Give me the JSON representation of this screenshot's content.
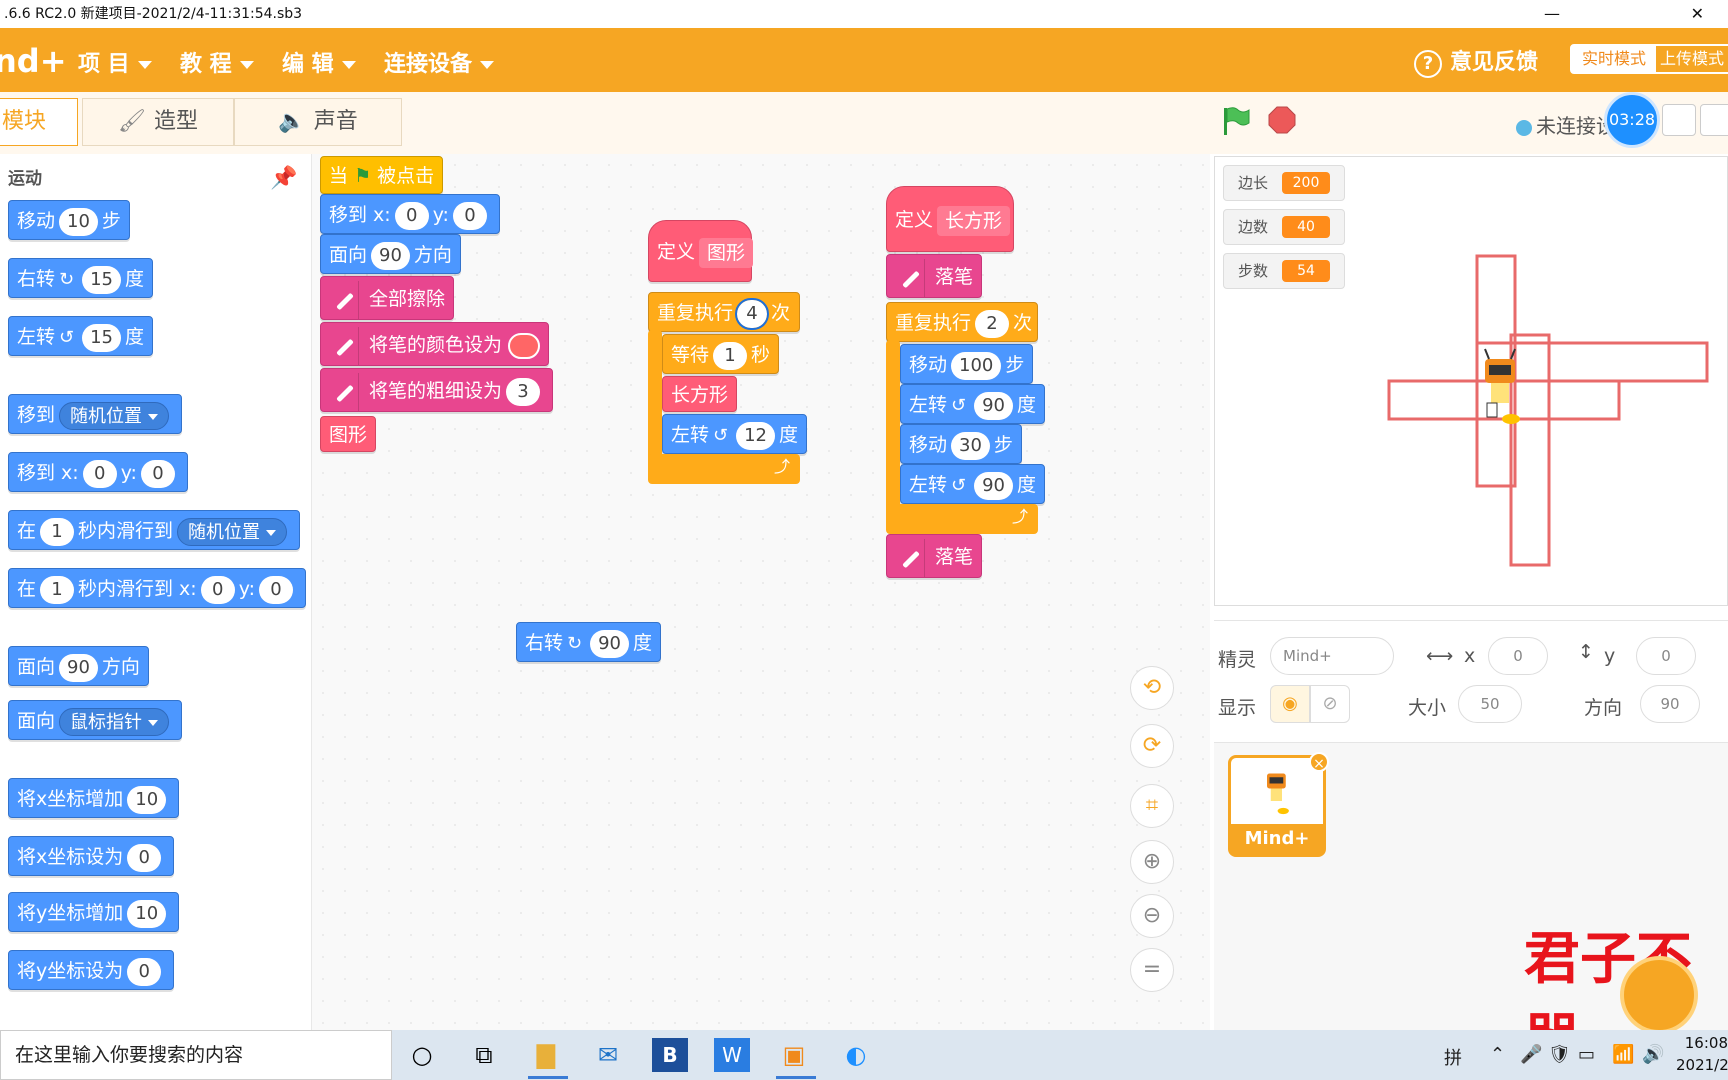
{
  "window": {
    "title": ".6.6 RC2.0   新建项目-2021/2/4-11:31:54.sb3",
    "min_glyph": "—",
    "close_glyph": "✕"
  },
  "menubar": {
    "logo": "nd+",
    "items": [
      "项 目",
      "教 程",
      "编 辑",
      "连接设备"
    ],
    "feedback": "意见反馈",
    "mode_realtime": "实时模式",
    "mode_upload": "上传模式"
  },
  "tabs": [
    {
      "label": "模块",
      "active": true
    },
    {
      "label": "造型",
      "active": false
    },
    {
      "label": "声音",
      "active": false
    }
  ],
  "stage_header": {
    "connection": "未连接设",
    "timer": "03:28"
  },
  "palette": {
    "category": "运动",
    "blocks": {
      "move": {
        "pre": "移动",
        "val": "10",
        "post": "步"
      },
      "turn_right": {
        "pre": "右转",
        "val": "15",
        "post": "度"
      },
      "turn_left": {
        "pre": "左转",
        "val": "15",
        "post": "度"
      },
      "goto_random": {
        "pre": "移到",
        "drop": "随机位置"
      },
      "goto_xy": {
        "pre": "移到 x:",
        "x": "0",
        "ylbl": "y:",
        "y": "0"
      },
      "glide_random": {
        "pre": "在",
        "val": "1",
        "mid": "秒内滑行到",
        "drop": "随机位置"
      },
      "glide_xy": {
        "pre": "在",
        "val": "1",
        "mid": "秒内滑行到 x:",
        "x": "0",
        "ylbl": "y:",
        "y": "0"
      },
      "point_dir": {
        "pre": "面向",
        "val": "90",
        "post": "方向"
      },
      "point_mouse": {
        "pre": "面向",
        "drop": "鼠标指针"
      },
      "change_x": {
        "pre": "将x坐标增加",
        "val": "10"
      },
      "set_x": {
        "pre": "将x坐标设为",
        "val": "0"
      },
      "change_y": {
        "pre": "将y坐标增加",
        "val": "10"
      },
      "set_y": {
        "pre": "将y坐标设为",
        "val": "0"
      }
    }
  },
  "script1": {
    "hat": {
      "pre": "当",
      "post": "被点击"
    },
    "goto": {
      "pre": "移到 x:",
      "x": "0",
      "ylbl": "y:",
      "y": "0"
    },
    "point": {
      "pre": "面向",
      "val": "90",
      "post": "方向"
    },
    "clear": "全部擦除",
    "set_color": "将笔的颜色设为",
    "set_size": {
      "pre": "将笔的粗细设为",
      "val": "3"
    },
    "call": "图形"
  },
  "script2": {
    "def": {
      "pre": "定义",
      "name": "图形"
    },
    "repeat": {
      "pre": "重复执行",
      "val": "4",
      "post": "次"
    },
    "wait": {
      "pre": "等待",
      "val": "1",
      "post": "秒"
    },
    "call": "长方形",
    "turn": {
      "pre": "左转",
      "val": "12",
      "post": "度"
    },
    "loop_end": "⤴"
  },
  "script3": {
    "def": {
      "pre": "定义",
      "name": "长方形"
    },
    "pen_down": "落笔",
    "repeat": {
      "pre": "重复执行",
      "val": "2",
      "post": "次"
    },
    "move1": {
      "pre": "移动",
      "val": "100",
      "post": "步"
    },
    "turn1": {
      "pre": "左转",
      "val": "90",
      "post": "度"
    },
    "move2": {
      "pre": "移动",
      "val": "30",
      "post": "步"
    },
    "turn2": {
      "pre": "左转",
      "val": "90",
      "post": "度"
    },
    "loop_end": "⤴",
    "pen_down2": "落笔"
  },
  "loose_block": {
    "pre": "右转",
    "val": "90",
    "post": "度"
  },
  "zoom_controls": [
    "⟲",
    "⟳",
    "⌗",
    "⊕",
    "⊖",
    "="
  ],
  "monitors": [
    {
      "label": "边长",
      "value": "200"
    },
    {
      "label": "边数",
      "value": "40"
    },
    {
      "label": "步数",
      "value": "54"
    }
  ],
  "sprite_info": {
    "sprite_label": "精灵",
    "sprite_name": "Mind+",
    "x_label": "x",
    "x_value": "0",
    "y_label": "y",
    "y_value": "0",
    "show_label": "显示",
    "size_label": "大小",
    "size_value": "50",
    "dir_label": "方向",
    "dir_value": "90"
  },
  "sprite_card": {
    "name": "Mind+",
    "close": "×"
  },
  "overlay_text": "君子不器",
  "taskbar": {
    "search": "在这里输入你要搜索的内容",
    "ime": "拼",
    "time": "16:08",
    "date": "2021/2"
  }
}
